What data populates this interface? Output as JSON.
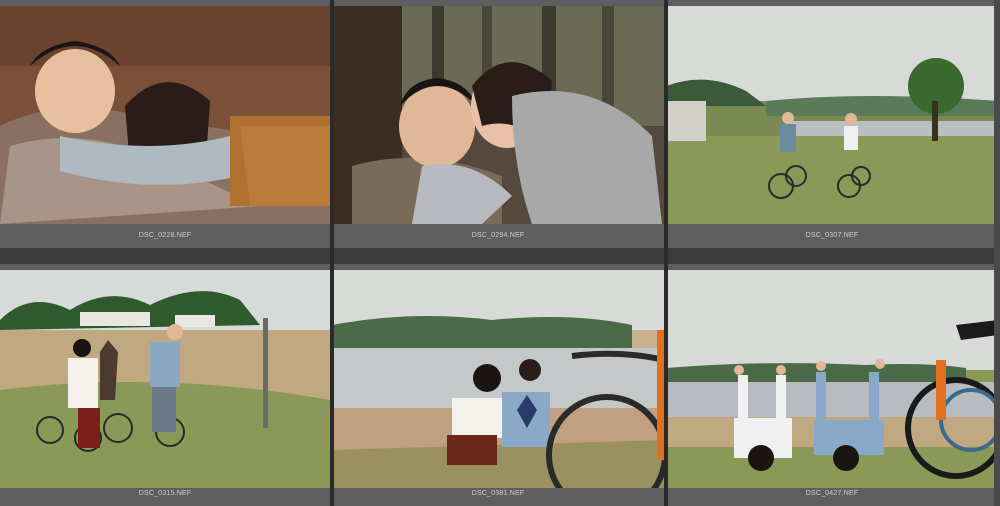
{
  "grid": {
    "cells": [
      {
        "filename": "DSC_0228.NEF",
        "scene": "couple-lying-blanket"
      },
      {
        "filename": "DSC_0294.NEF",
        "scene": "couple-kiss-forest"
      },
      {
        "filename": "DSC_0307.NEF",
        "scene": "couple-riding-bicycles-lakeside"
      },
      {
        "filename": "DSC_0315.NEF",
        "scene": "couple-standing-bicycles-beach"
      },
      {
        "filename": "DSC_0381.NEF",
        "scene": "couple-sitting-by-lake"
      },
      {
        "filename": "DSC_0427.NEF",
        "scene": "couple-lying-peace-signs"
      }
    ]
  },
  "colors": {
    "background": "#3b3b3b",
    "cell_frame": "#5e5e5e",
    "caption_text": "#d0d0d0"
  }
}
